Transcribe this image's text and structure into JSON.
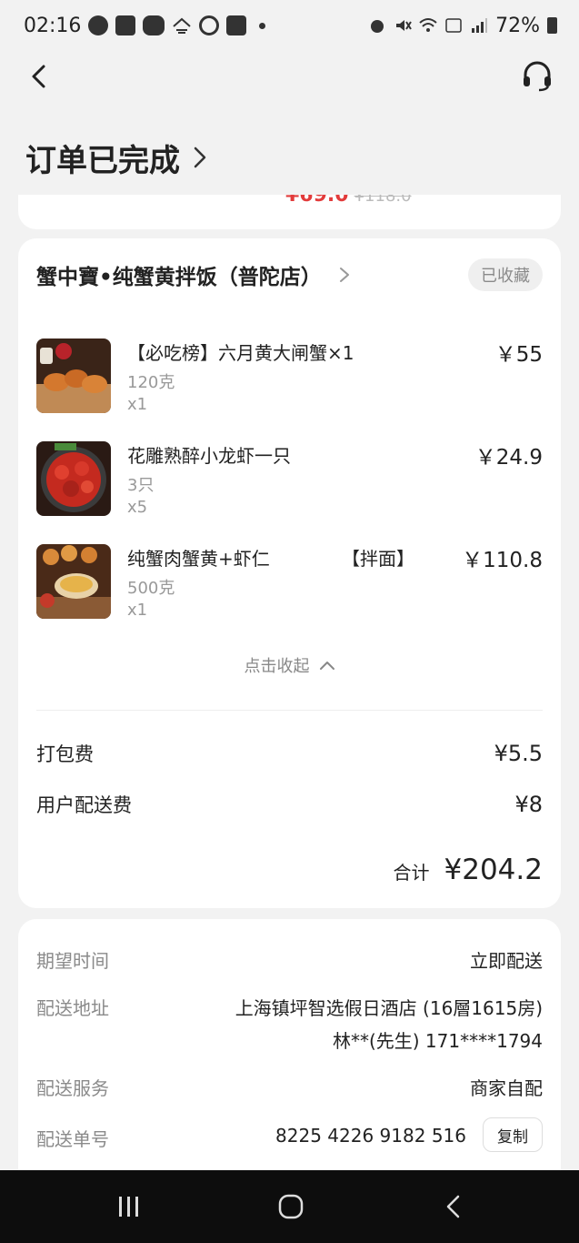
{
  "status_bar": {
    "time": "02:16",
    "battery": "72%",
    "icons_left": [
      "minus-circle-icon",
      "grid-icon",
      "line-icon",
      "home-wifi-icon",
      "target-icon",
      "app-icon"
    ],
    "icons_right": [
      "alarm-icon",
      "mute-icon",
      "wifi-icon",
      "volte-icon",
      "signal-icon",
      "battery-icon"
    ]
  },
  "header": {
    "title": "订单已完成"
  },
  "prev_card": {
    "partial_text": "¥69.0",
    "partial_text_old": "¥118.0"
  },
  "store": {
    "name": "蟹中寶•纯蟹黄拌饭（普陀店）",
    "favorite_label": "已收藏"
  },
  "items": [
    {
      "name": "【必吃榜】六月黄大闸蟹×1",
      "name_extra": "",
      "spec": "120克",
      "qty": "x1",
      "price": "￥55"
    },
    {
      "name": "花雕熟醉小龙虾一只",
      "name_extra": "",
      "spec": "3只",
      "qty": "x5",
      "price": "￥24.9"
    },
    {
      "name": "纯蟹肉蟹黄+虾仁",
      "name_extra": "【拌面】",
      "spec": "500克",
      "qty": "x1",
      "price": "￥110.8"
    }
  ],
  "collapse_label": "点击收起",
  "fees": {
    "packing_label": "打包费",
    "packing_value": "¥5.5",
    "delivery_label": "用户配送费",
    "delivery_value": "¥8"
  },
  "total": {
    "label": "合计",
    "amount": "¥204.2"
  },
  "delivery": {
    "time_label": "期望时间",
    "time_value": "立即配送",
    "address_label": "配送地址",
    "address_line1": "上海镇坪智选假日酒店 (16層1615房)",
    "address_line2": "林**(先生) 171****1794",
    "service_label": "配送服务",
    "service_value": "商家自配",
    "number_label": "配送单号",
    "number_value": "8225 4226 9182 516",
    "copy_label": "复制"
  },
  "colors": {
    "accent_red": "#e23b3b",
    "muted": "#8a8a8a",
    "background": "#f2f2f2"
  }
}
